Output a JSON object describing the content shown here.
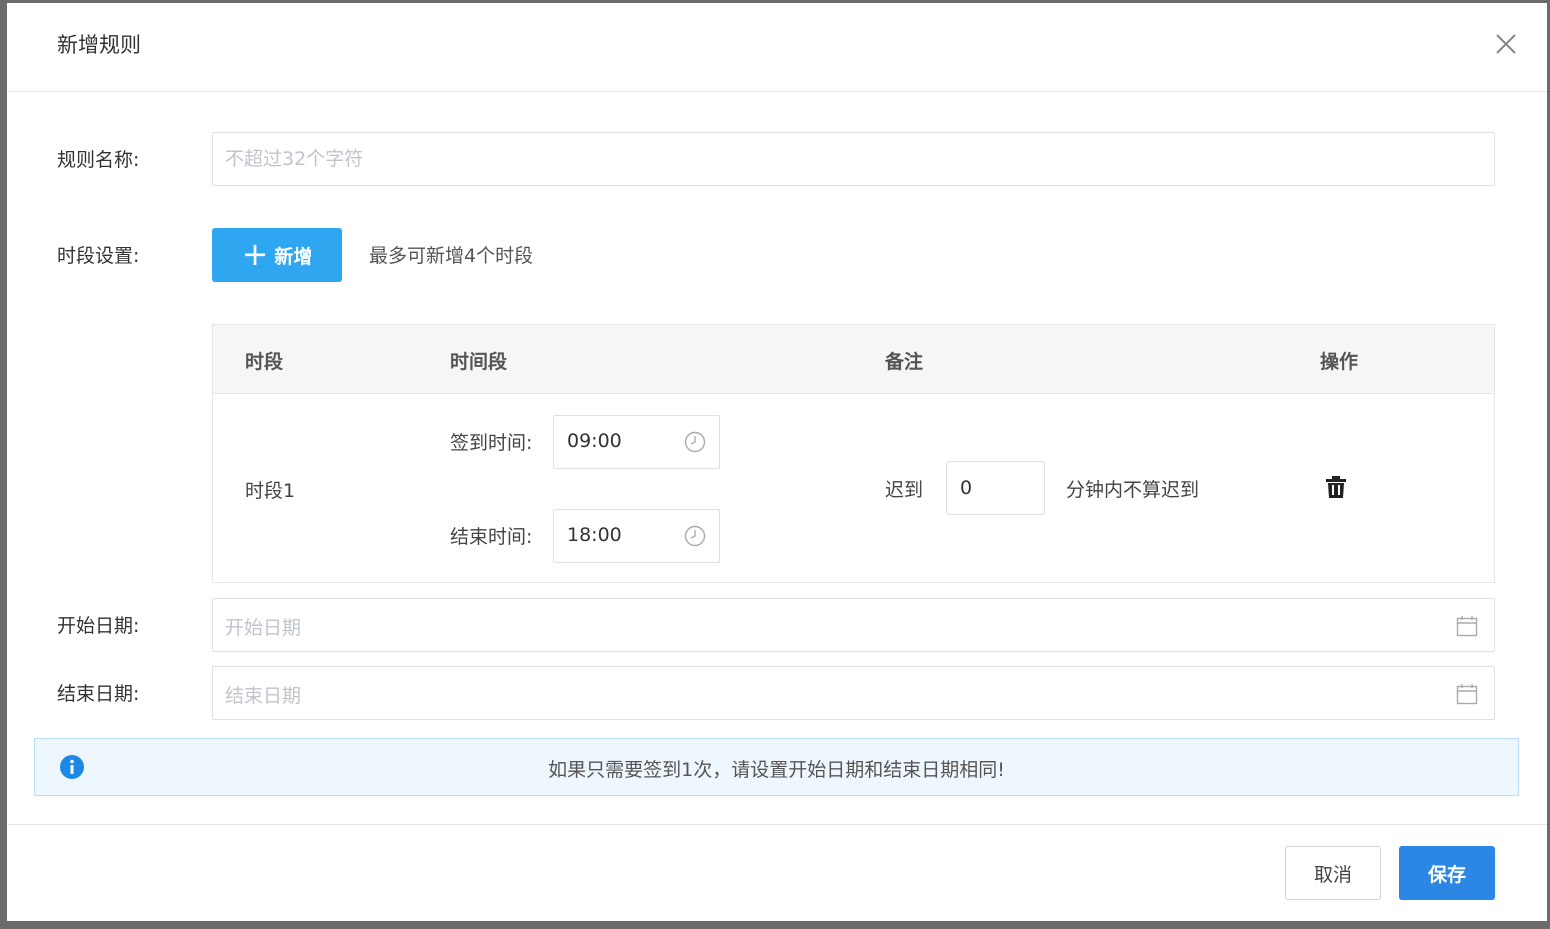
{
  "dialog": {
    "title": "新增规则"
  },
  "form": {
    "rule_name_label": "规则名称:",
    "rule_name_placeholder": "不超过32个字符",
    "period_label": "时段设置:",
    "add_button_label": "新增",
    "add_hint": "最多可新增4个时段",
    "start_date_label": "开始日期:",
    "start_date_placeholder": "开始日期",
    "end_date_label": "结束日期:",
    "end_date_placeholder": "结束日期"
  },
  "table": {
    "headers": [
      "时段",
      "时间段",
      "备注",
      "操作"
    ],
    "rows": [
      {
        "period": "时段1",
        "checkin_label": "签到时间:",
        "checkin_time": "09:00",
        "end_label": "结束时间:",
        "end_time": "18:00",
        "late_prefix": "迟到",
        "late_minutes": "0",
        "late_suffix": "分钟内不算迟到"
      }
    ]
  },
  "info": {
    "message": "如果只需要签到1次，请设置开始日期和结束日期相同!"
  },
  "footer": {
    "cancel_label": "取消",
    "save_label": "保存"
  },
  "icons": {
    "close": "close-icon",
    "clock": "clock-icon",
    "calendar": "calendar-icon",
    "trash": "trash-icon",
    "info": "info-icon",
    "plus": "plus-icon"
  },
  "colors": {
    "add_button": "#2ea6f0",
    "save_button": "#2b87e3",
    "info_background": "#eef7fd",
    "info_icon": "#1e88e5"
  }
}
